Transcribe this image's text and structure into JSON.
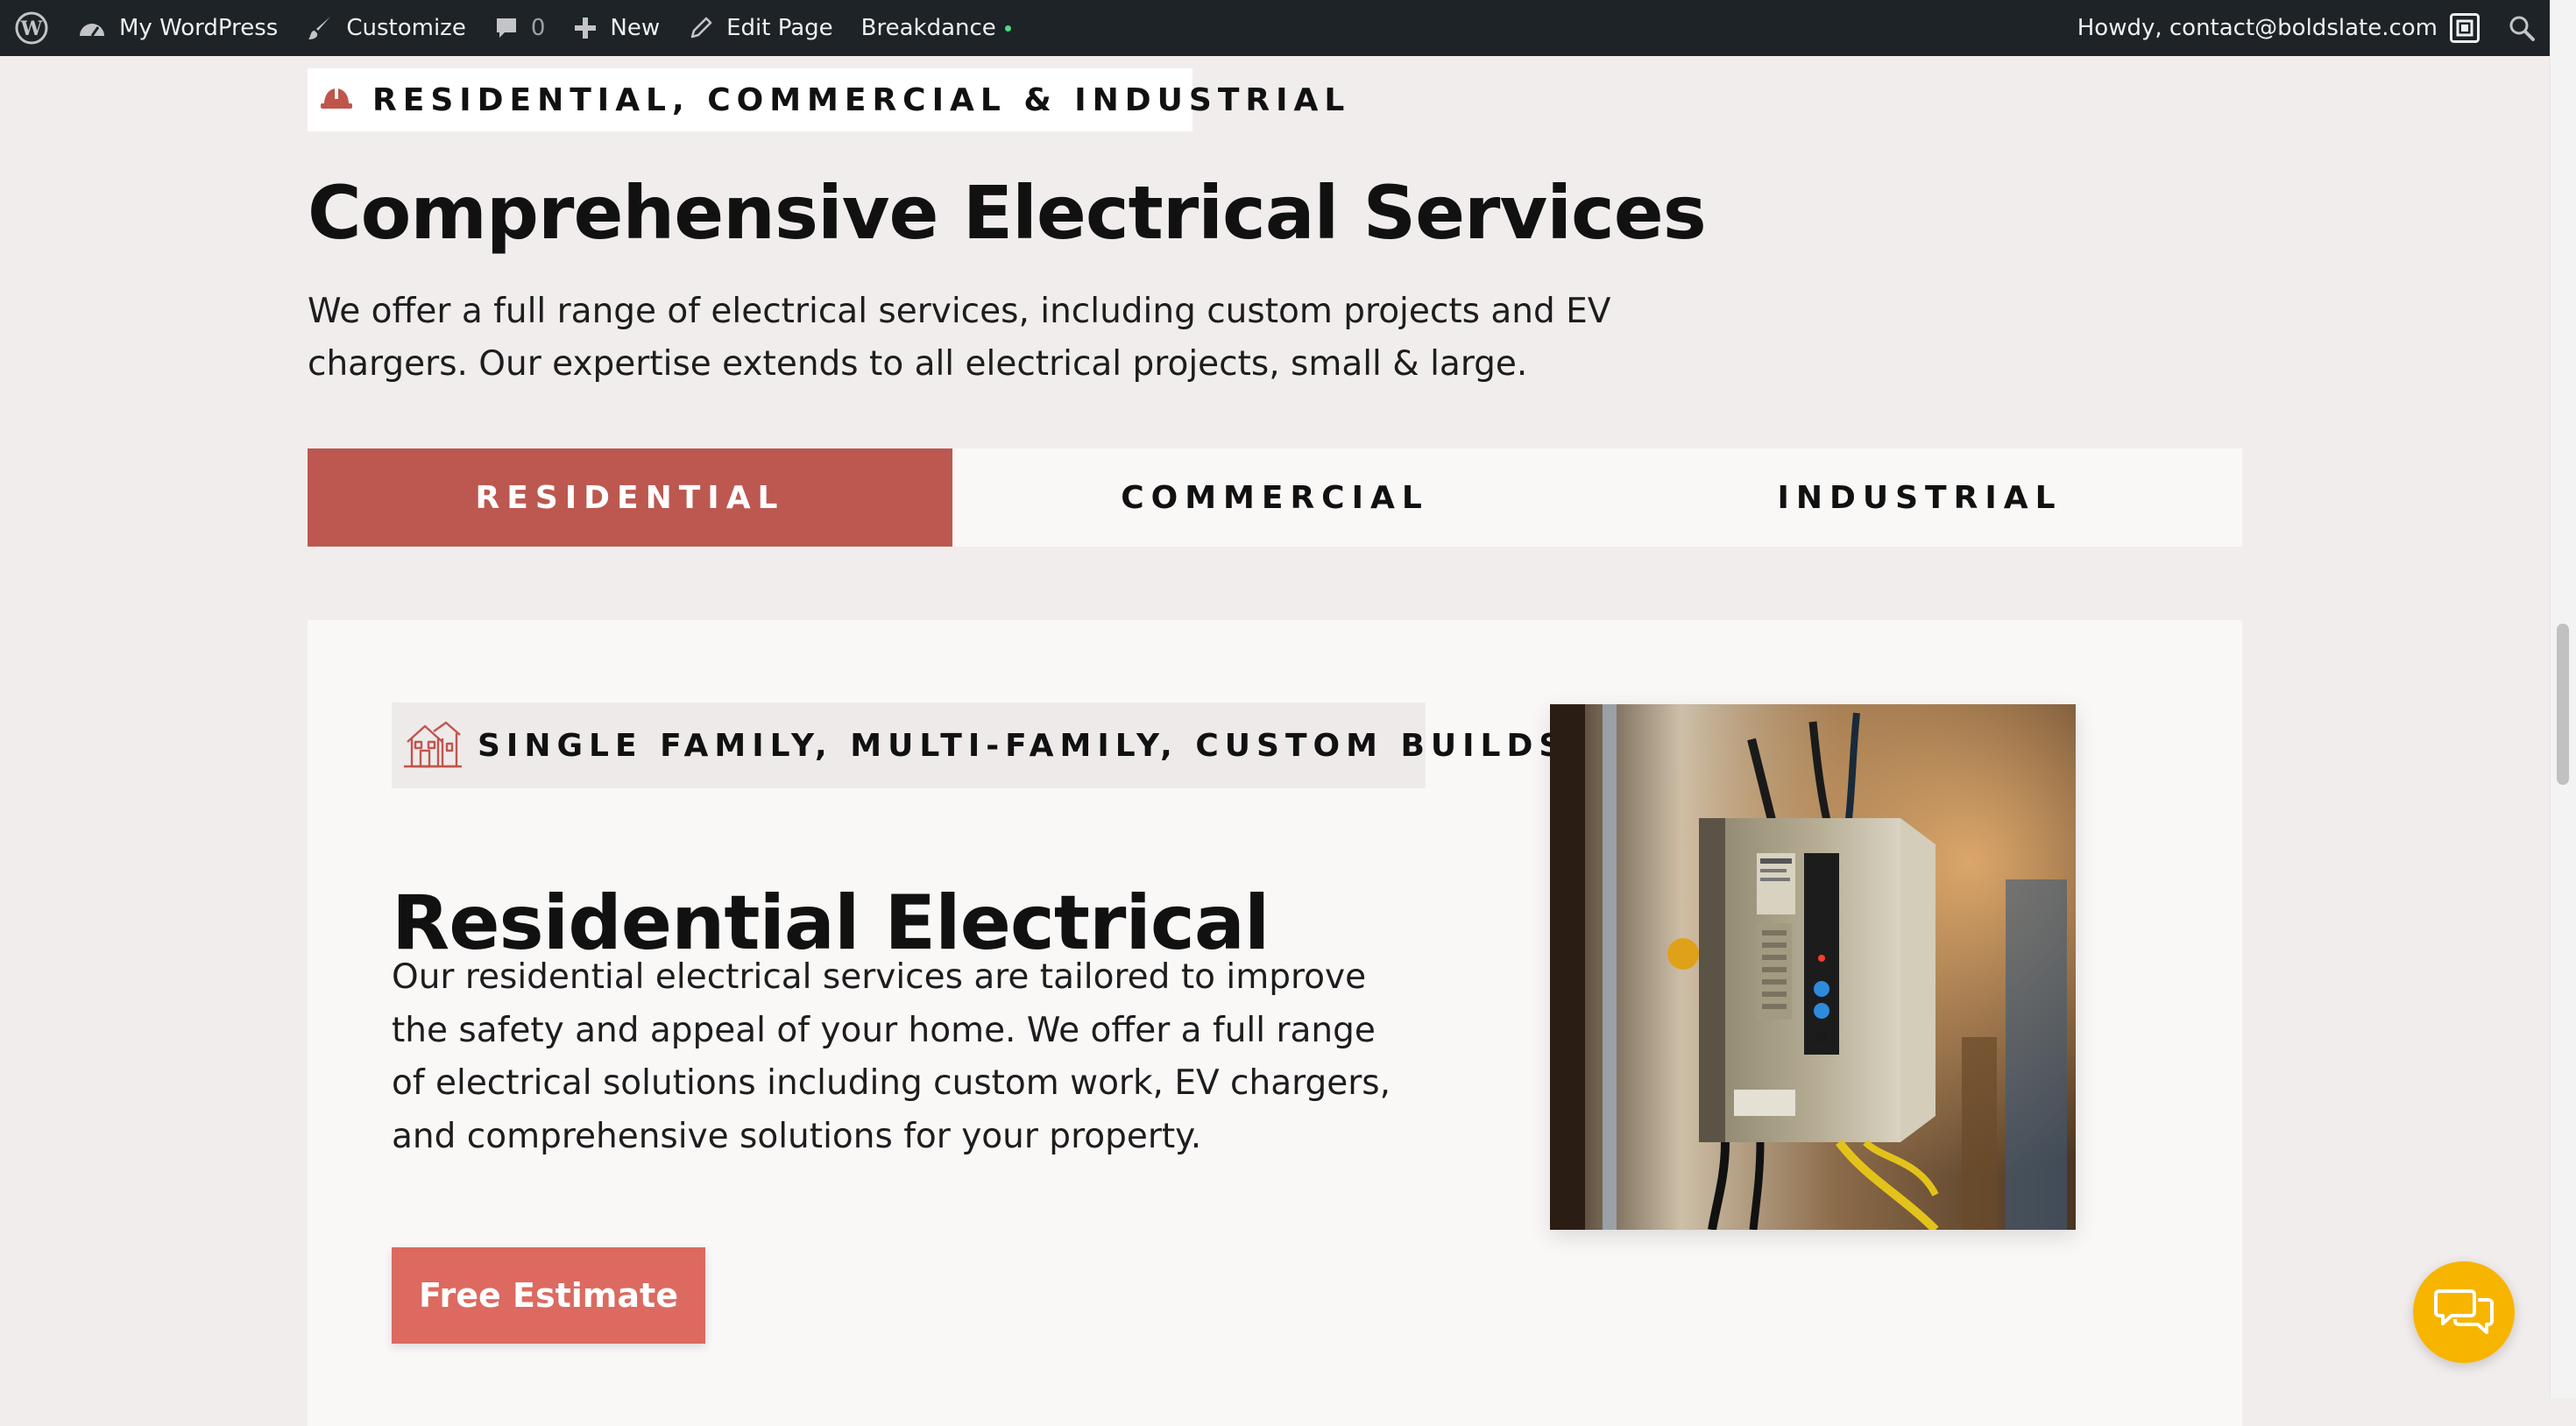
{
  "admin_bar": {
    "site_name": "My WordPress",
    "customize": "Customize",
    "comments_count": "0",
    "new": "New",
    "edit_page": "Edit Page",
    "builder": "Breakdance",
    "howdy": "Howdy, contact@boldslate.com"
  },
  "hero": {
    "eyebrow": "RESIDENTIAL, COMMERCIAL & INDUSTRIAL",
    "title": "Comprehensive Electrical Services",
    "intro": "We offer a full range of electrical services, including custom projects and EV chargers. Our expertise extends to all electrical projects, small & large."
  },
  "tabs": [
    {
      "label": "RESIDENTIAL",
      "active": true
    },
    {
      "label": "COMMERCIAL",
      "active": false
    },
    {
      "label": "INDUSTRIAL",
      "active": false
    }
  ],
  "panel": {
    "eyebrow": "SINGLE FAMILY, MULTI-FAMILY, CUSTOM BUILDS",
    "title": "Residential Electrical",
    "text": "Our residential electrical services are tailored to improve the safety and appeal of your home. We offer a full range of electrical solutions including custom work, EV chargers, and comprehensive solutions for your property.",
    "cta": "Free Estimate",
    "image_icon": "electrical-panel-photo"
  },
  "colors": {
    "page_bg": "#f2eded",
    "accent": "#bc5850",
    "cta": "#dc6a60",
    "chat": "#f7b500",
    "admin_bar": "#1d2327"
  },
  "icons": [
    "wordpress-icon",
    "dashboard-icon",
    "brush-icon",
    "comment-icon",
    "plus-icon",
    "pencil-icon",
    "hardhat-icon",
    "house-icon",
    "chat-icon",
    "search-icon",
    "avatar-icon"
  ]
}
